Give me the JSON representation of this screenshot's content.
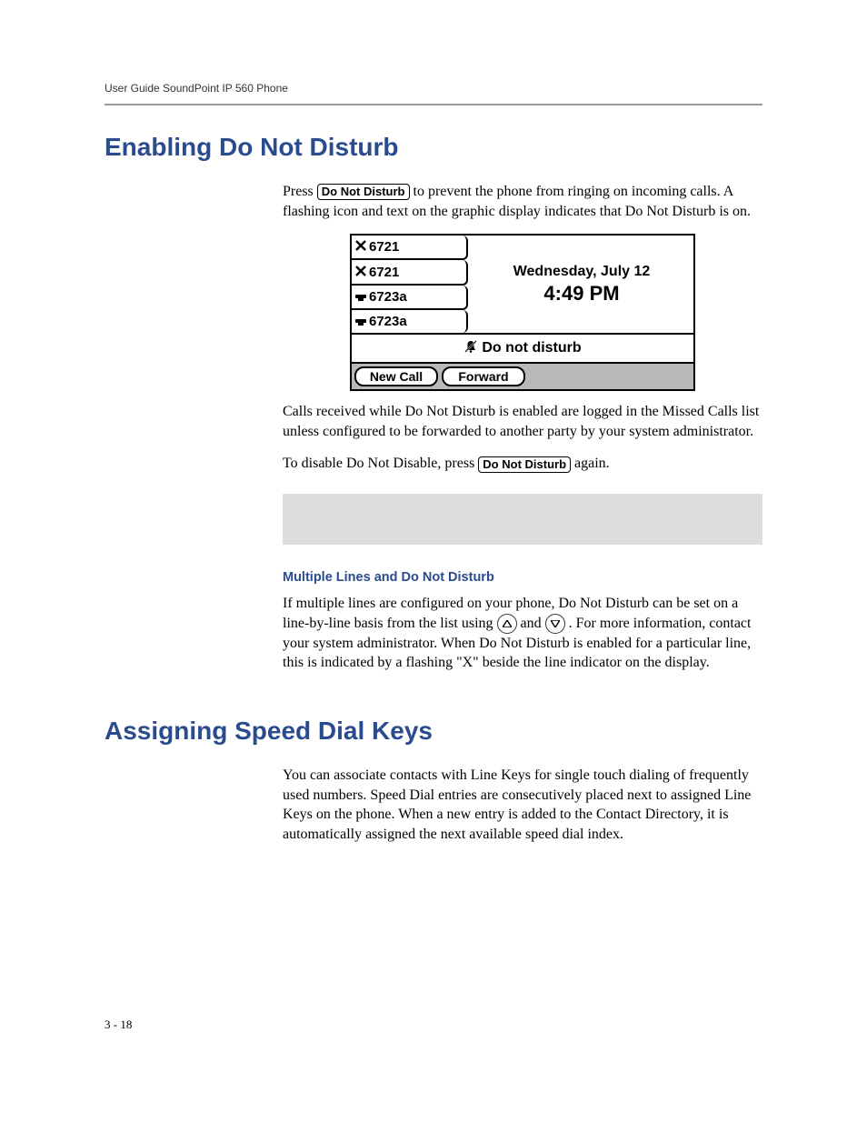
{
  "header": {
    "running_head": "User Guide SoundPoint IP 560 Phone"
  },
  "section1": {
    "title": "Enabling Do Not Disturb",
    "p1_a": "Press ",
    "keycap_dnd": "Do Not Disturb",
    "p1_b": " to prevent the phone from ringing on incoming calls. A flashing icon and text on the graphic display indicates that Do Not Disturb is on.",
    "p2": "Calls received while Do Not Disturb is enabled are logged in the Missed Calls list unless configured to be forwarded to another party by your system administrator.",
    "p3_a": "To disable Do Not Disable, press ",
    "p3_b": " again.",
    "sub1_title": "Multiple Lines and Do Not Disturb",
    "sub1_p_a": "If multiple lines are configured on your phone, Do Not Disturb can be set on a line-by-line basis from the list using ",
    "sub1_and": " and ",
    "sub1_p_b": ". For more information, contact your system administrator. When Do Not Disturb is enabled for a particular line, this is indicated by a flashing \"X\" beside the line indicator on the display."
  },
  "phone_screen": {
    "lines": [
      {
        "icon": "x",
        "label": "6721"
      },
      {
        "icon": "x",
        "label": "6721"
      },
      {
        "icon": "phone",
        "label": "6723a"
      },
      {
        "icon": "phone",
        "label": "6723a"
      }
    ],
    "date": "Wednesday, July 12",
    "time": "4:49 PM",
    "dnd_label": "Do not disturb",
    "softkeys": [
      "New Call",
      "Forward"
    ]
  },
  "section2": {
    "title": "Assigning Speed Dial Keys",
    "p1": "You can associate contacts with Line Keys for single touch dialing of frequently used numbers. Speed Dial entries are consecutively placed next to assigned Line Keys on the phone. When a new entry is added to the Contact Directory, it is automatically assigned the next available speed dial index."
  },
  "footer": {
    "page_num": "3 - 18"
  }
}
